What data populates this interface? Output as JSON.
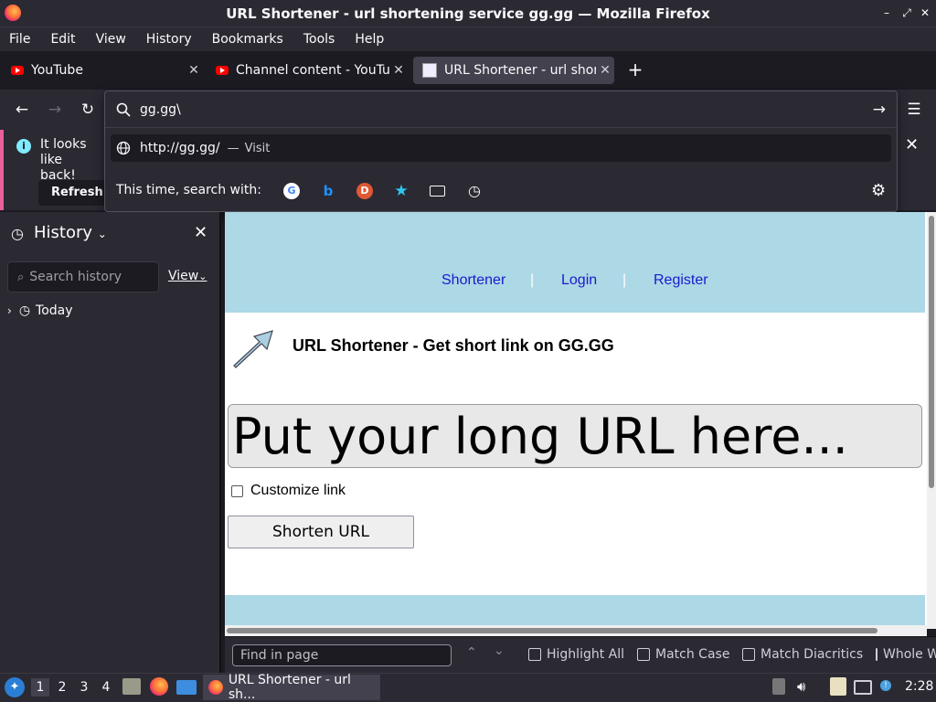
{
  "window": {
    "title": "URL Shortener - url shortening service gg.gg — Mozilla Firefox"
  },
  "menu": [
    "File",
    "Edit",
    "View",
    "History",
    "Bookmarks",
    "Tools",
    "Help"
  ],
  "tabs": [
    {
      "label": "YouTube"
    },
    {
      "label": "Channel content - YouTube"
    },
    {
      "label": "URL Shortener - url shortening service gg.gg"
    }
  ],
  "urlbar": {
    "value": "gg.gg\\",
    "suggestion_url": "http://gg.gg/",
    "suggestion_sep": "—",
    "suggestion_action": "Visit",
    "search_with": "This time, search with:"
  },
  "notification": {
    "text": "It looks like back!",
    "text_line1": "It looks like",
    "text_line2": "back!",
    "button": "Refresh"
  },
  "sidebar": {
    "title": "History",
    "search_placeholder": "Search history",
    "view_label": "View",
    "groups": [
      "Today"
    ]
  },
  "page": {
    "nav": [
      "Shortener",
      "Login",
      "Register"
    ],
    "nav_sep": "|",
    "heading": "URL Shortener - Get short link on GG.GG",
    "url_placeholder": "Put your long URL here...",
    "customize_label": "Customize link",
    "shorten_button": "Shorten URL"
  },
  "findbar": {
    "placeholder": "Find in page",
    "options": [
      "Highlight All",
      "Match Case",
      "Match Diacritics",
      "Whole Words"
    ]
  },
  "taskbar": {
    "workspaces": [
      "1",
      "2",
      "3",
      "4"
    ],
    "active_window": "URL Shortener - url sh...",
    "clock": "2:28"
  }
}
